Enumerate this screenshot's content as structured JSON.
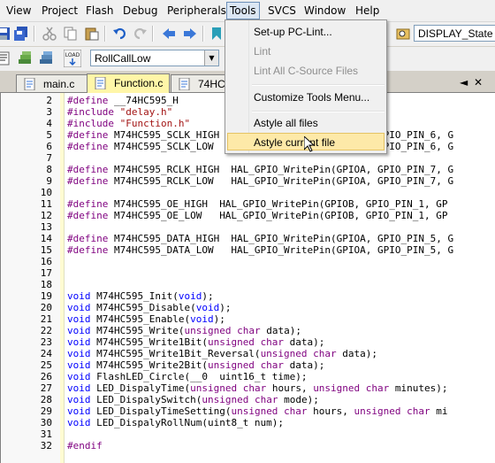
{
  "menubar": {
    "items": [
      "View",
      "Project",
      "Flash",
      "Debug",
      "Peripherals",
      "Tools",
      "SVCS",
      "Window",
      "Help"
    ],
    "active": "Tools"
  },
  "toolbar": {
    "target_combo": "RollCallLow",
    "display_combo": "DISPLAY_State"
  },
  "tabs": [
    {
      "label": "main.c",
      "active": false
    },
    {
      "label": "Function.c",
      "active": true
    },
    {
      "label": "74HC5",
      "active": false
    }
  ],
  "tab_controls": {
    "arrow": "◄",
    "close": "✕"
  },
  "tools_menu": {
    "items": [
      {
        "label": "Set-up PC-Lint...",
        "disabled": false
      },
      {
        "label": "Lint",
        "disabled": true
      },
      {
        "label": "Lint All C-Source Files",
        "disabled": true
      },
      {
        "label": "Customize Tools Menu...",
        "disabled": false
      },
      {
        "label": "Astyle all files",
        "disabled": false
      },
      {
        "label": "Astyle current file",
        "disabled": false,
        "hover": true
      }
    ]
  },
  "code_lines": [
    {
      "n": "2",
      "text": "#define __74HC595_H"
    },
    {
      "n": "3",
      "text": "#include \"delay.h\""
    },
    {
      "n": "4",
      "text": "#include \"Function.h\""
    },
    {
      "n": "5",
      "text": "#define M74HC595_SCLK_HIGH  HAL_GPIO_WritePin(GPIOB, GPIO_PIN_6, G"
    },
    {
      "n": "6",
      "text": "#define M74HC595_SCLK_LOW   HAL_GPIO_WritePin(GPIOB, GPIO_PIN_6, G"
    },
    {
      "n": "7",
      "text": ""
    },
    {
      "n": "8",
      "text": "#define M74HC595_RCLK_HIGH  HAL_GPIO_WritePin(GPIOA, GPIO_PIN_7, G"
    },
    {
      "n": "9",
      "text": "#define M74HC595_RCLK_LOW   HAL_GPIO_WritePin(GPIOA, GPIO_PIN_7, G"
    },
    {
      "n": "10",
      "text": ""
    },
    {
      "n": "11",
      "text": "#define M74HC595_OE_HIGH  HAL_GPIO_WritePin(GPIOB, GPIO_PIN_1, GP"
    },
    {
      "n": "12",
      "text": "#define M74HC595_OE_LOW   HAL_GPIO_WritePin(GPIOB, GPIO_PIN_1, GP"
    },
    {
      "n": "13",
      "text": ""
    },
    {
      "n": "14",
      "text": "#define M74HC595_DATA_HIGH  HAL_GPIO_WritePin(GPIOA, GPIO_PIN_5, G"
    },
    {
      "n": "15",
      "text": "#define M74HC595_DATA_LOW   HAL_GPIO_WritePin(GPIOA, GPIO_PIN_5, G"
    },
    {
      "n": "16",
      "text": ""
    },
    {
      "n": "17",
      "text": ""
    },
    {
      "n": "18",
      "text": ""
    },
    {
      "n": "19",
      "text": "void M74HC595_Init(void);"
    },
    {
      "n": "20",
      "text": "void M74HC595_Disable(void);"
    },
    {
      "n": "21",
      "text": "void M74HC595_Enable(void);"
    },
    {
      "n": "22",
      "text": "void M74HC595_Write(unsigned char data);"
    },
    {
      "n": "23",
      "text": "void M74HC595_Write1Bit(unsigned char data);"
    },
    {
      "n": "24",
      "text": "void M74HC595_Write1Bit_Reversal(unsigned char data);"
    },
    {
      "n": "25",
      "text": "void M74HC595_Write2Bit(unsigned char data);"
    },
    {
      "n": "26",
      "text": "void FlashLED_Circle(__0  uint16_t time);"
    },
    {
      "n": "27",
      "text": "void LED_DispalyTime(unsigned char hours, unsigned char minutes);"
    },
    {
      "n": "28",
      "text": "void LED_DispalySwitch(unsigned char mode);"
    },
    {
      "n": "29",
      "text": "void LED_DispalyTimeSetting(unsigned char hours, unsigned char mi"
    },
    {
      "n": "30",
      "text": "void LED_DispalyRollNum(uint8_t num);"
    },
    {
      "n": "31",
      "text": ""
    },
    {
      "n": "32",
      "text": "#endif"
    }
  ]
}
